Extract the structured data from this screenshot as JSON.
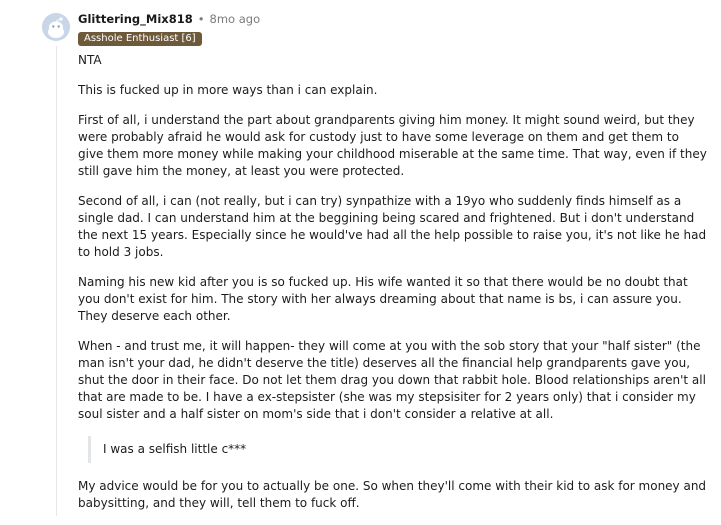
{
  "comment": {
    "author": "Glittering_Mix818",
    "separator": "•",
    "time_ago": "8mo ago",
    "flair": "Asshole Enthusiast [6]",
    "paragraphs": [
      "NTA",
      "This is fucked up in more ways than i can explain.",
      "First of all, i understand the part about grandparents giving him money. It might sound weird, but they were probably afraid he would ask for custody just to have some leverage on them and get them to give them more money while making your childhood miserable at the same time. That way, even if they still gave him the money, at least you were protected.",
      "Second of all, i can (not really, but i can try) synpathize with a 19yo who suddenly finds himself as a single dad. I can understand him at the beggining being scared and frightened. But i don't understand the next 15 years. Especially since he would've had all the help possible to raise you, it's not like he had to hold 3 jobs.",
      "Naming his new kid after you is so fucked up. His wife wanted it so that there would be no doubt that you don't exist for him. The story with her always dreaming about that name is bs, i can assure you. They deserve each other.",
      "When - and trust me, it will happen- they will come at you with the sob story that your \"half sister\" (the man isn't your dad, he didn't deserve the title) deserves all the financial help grandparents gave you, shut the door in their face. Do not let them drag you down that rabbit hole. Blood relationships aren't all that are made to be. I have a ex-stepsister (she was my stepsisiter for 2 years only) that i consider my soul sister and a half sister on mom's side that i don't consider a relative at all."
    ],
    "quote": "I was a selfish little c***",
    "closing": "My advice would be for you to actually be one. So when they'll come with their kid to ask for money and babysitting, and they will, tell them to fuck off."
  }
}
